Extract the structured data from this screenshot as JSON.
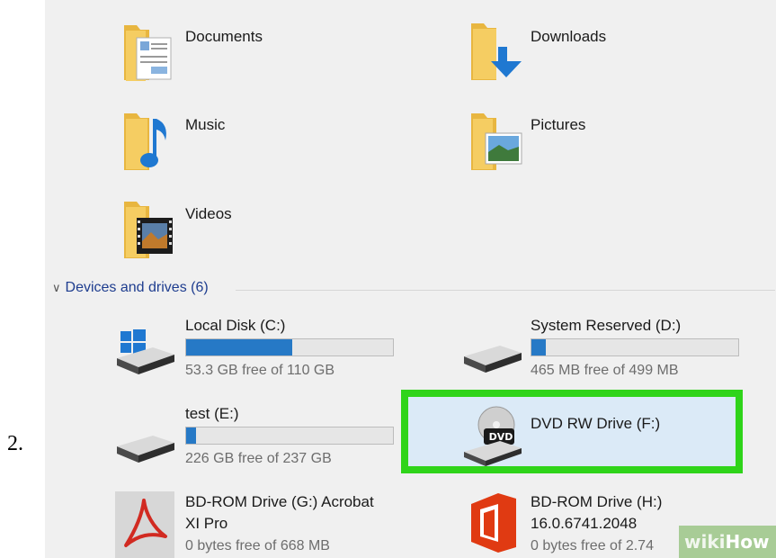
{
  "step_number": "2.",
  "folders": [
    {
      "label": "Documents",
      "icon": "documents-folder-icon"
    },
    {
      "label": "Downloads",
      "icon": "downloads-folder-icon"
    },
    {
      "label": "Music",
      "icon": "music-folder-icon"
    },
    {
      "label": "Pictures",
      "icon": "pictures-folder-icon"
    },
    {
      "label": "Videos",
      "icon": "videos-folder-icon"
    }
  ],
  "devices_section": {
    "title": "Devices and drives (6)"
  },
  "drives": [
    {
      "label": "Local Disk (C:)",
      "free_text": "53.3 GB free of 110 GB",
      "used_fraction": 0.515,
      "icon": "windows-drive-icon"
    },
    {
      "label": "System Reserved (D:)",
      "free_text": "465 MB free of 499 MB",
      "used_fraction": 0.068,
      "icon": "hard-drive-icon"
    },
    {
      "label": "test (E:)",
      "free_text": "226 GB free of 237 GB",
      "used_fraction": 0.046,
      "icon": "hard-drive-icon"
    },
    {
      "label": "DVD RW Drive (F:)",
      "icon": "dvd-drive-icon",
      "badge": "DVD",
      "highlighted": true
    },
    {
      "label_line1": "BD-ROM Drive (G:) Acrobat",
      "label_line2": "XI Pro",
      "free_text": "0 bytes free of 668 MB",
      "icon": "acrobat-icon"
    },
    {
      "label_line1": "BD-ROM Drive (H:)",
      "label_line2": "16.0.6741.2048",
      "free_text": "0 bytes free of 2.74",
      "icon": "office-icon"
    }
  ],
  "colors": {
    "accent_bar": "#2679c6",
    "highlight_border": "#2fd41a",
    "section_header": "#1e3d8f"
  },
  "watermark": {
    "part1": "wiki",
    "part2": "How"
  }
}
